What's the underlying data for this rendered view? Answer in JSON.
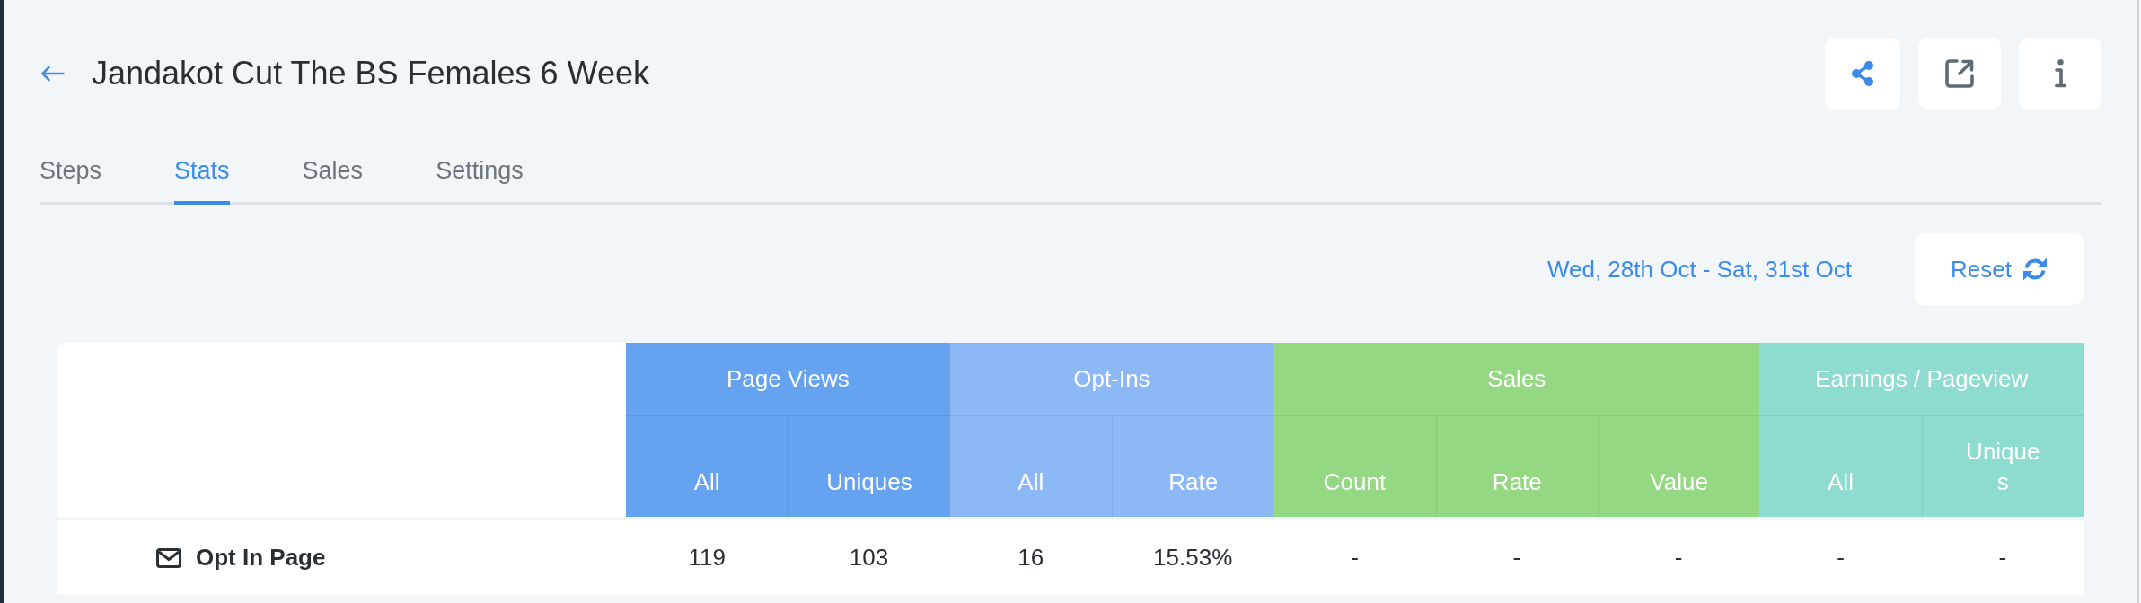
{
  "page": {
    "title": "Jandakot Cut The BS Females 6 Week"
  },
  "tabs": [
    {
      "label": "Steps",
      "selected": false
    },
    {
      "label": "Stats",
      "selected": true
    },
    {
      "label": "Sales",
      "selected": false
    },
    {
      "label": "Settings",
      "selected": false
    }
  ],
  "date_range": "Wed, 28th Oct - Sat, 31st Oct",
  "reset_button": {
    "label": "Reset"
  },
  "stats_table": {
    "column_groups": [
      {
        "label": "Page Views",
        "color": "#65a3f1",
        "columns": [
          "All",
          "Uniques"
        ]
      },
      {
        "label": "Opt-Ins",
        "color": "#8cb8f5",
        "columns": [
          "All",
          "Rate"
        ]
      },
      {
        "label": "Sales",
        "color": "#94d884",
        "columns": [
          "Count",
          "Rate",
          "Value"
        ]
      },
      {
        "label": "Earnings / Pageview",
        "color": "#8edbcf",
        "columns": [
          "All",
          "Uniques"
        ]
      }
    ],
    "rows": [
      {
        "name": "Opt In Page",
        "cells": [
          "119",
          "103",
          "16",
          "15.53%",
          "-",
          "-",
          "-",
          "-",
          "-"
        ]
      }
    ]
  }
}
